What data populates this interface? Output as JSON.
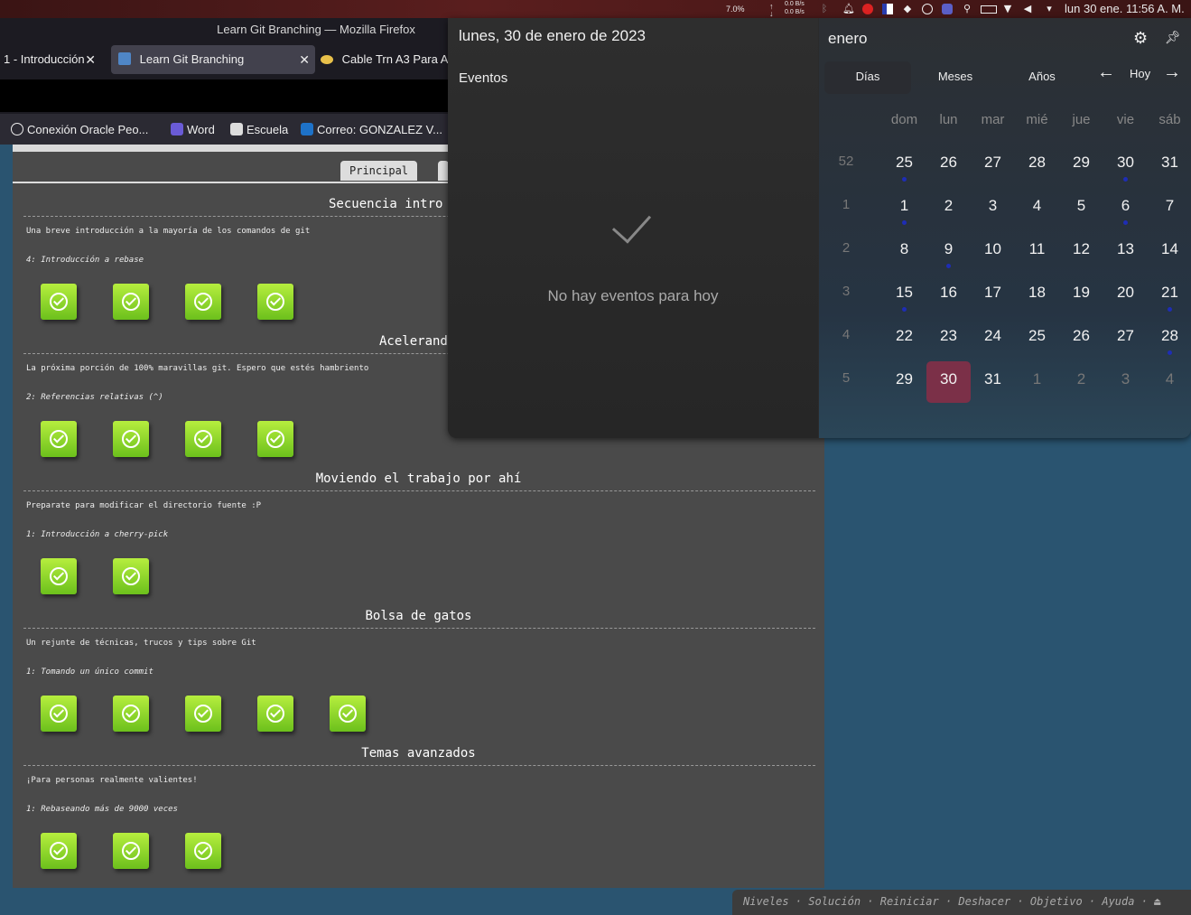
{
  "topbar": {
    "cpu": "7.0%",
    "net_up": "0.0 B/s",
    "net_down": "0.0 B/s",
    "clock": "lun 30 ene.  11:56 A. M."
  },
  "firefox": {
    "window_title": "Learn Git Branching — Mozilla Firefox",
    "tabs": [
      {
        "label": "1 - Introducción"
      },
      {
        "label": "Learn Git Branching"
      },
      {
        "label": "Cable Trn A3 Para A"
      }
    ],
    "bookmarks": [
      {
        "label": "Conexión Oracle Peo..."
      },
      {
        "label": "Word"
      },
      {
        "label": "Escuela"
      },
      {
        "label": "Correo: GONZALEZ V..."
      }
    ]
  },
  "git_page": {
    "tab_main": "Principal",
    "sections": [
      {
        "title": "Secuencia intro",
        "desc": "Una breve introducción a la mayoría de los comandos de git",
        "sub": "4: Introducción a rebase",
        "levels": 4
      },
      {
        "title": "Acelerand",
        "desc": "La próxima porción de 100% maravillas git. Espero que estés hambriento",
        "sub": "2: Referencias relativas (^)",
        "levels": 4
      },
      {
        "title": "Moviendo el trabajo por ahí",
        "desc": "Preparate para modificar el directorio fuente :P",
        "sub": "1: Introducción a cherry-pick",
        "levels": 2
      },
      {
        "title": "Bolsa de gatos",
        "desc": "Un rejunte de técnicas, trucos y tips sobre Git",
        "sub": "1: Tomando un único commit",
        "levels": 5
      },
      {
        "title": "Temas avanzados",
        "desc": "¡Para personas realmente valientes!",
        "sub": "1: Rebaseando más de 9000 veces",
        "levels": 3
      }
    ],
    "bottom_bar": "Niveles · Solución · Reiniciar · Deshacer · Objetivo · Ayuda · ⏏"
  },
  "calendar": {
    "date_header": "lunes, 30 de enero de 2023",
    "events_label": "Eventos",
    "no_events": "No hay eventos para hoy",
    "month": "enero",
    "segments": [
      "Días",
      "Meses",
      "Años"
    ],
    "today_label": "Hoy",
    "weekdays": [
      "dom",
      "lun",
      "mar",
      "mié",
      "jue",
      "vie",
      "sáb"
    ],
    "weeks": [
      {
        "num": "52",
        "days": [
          {
            "d": "25",
            "dot": true
          },
          {
            "d": "26"
          },
          {
            "d": "27"
          },
          {
            "d": "28"
          },
          {
            "d": "29"
          },
          {
            "d": "30",
            "dot": true
          },
          {
            "d": "31"
          }
        ],
        "dim": true
      },
      {
        "num": "1",
        "days": [
          {
            "d": "1",
            "dot": true
          },
          {
            "d": "2"
          },
          {
            "d": "3"
          },
          {
            "d": "4"
          },
          {
            "d": "5"
          },
          {
            "d": "6",
            "dot": true
          },
          {
            "d": "7"
          }
        ]
      },
      {
        "num": "2",
        "days": [
          {
            "d": "8"
          },
          {
            "d": "9",
            "dot": true
          },
          {
            "d": "10"
          },
          {
            "d": "11"
          },
          {
            "d": "12"
          },
          {
            "d": "13"
          },
          {
            "d": "14"
          }
        ]
      },
      {
        "num": "3",
        "days": [
          {
            "d": "15",
            "dot": true
          },
          {
            "d": "16"
          },
          {
            "d": "17"
          },
          {
            "d": "18"
          },
          {
            "d": "19"
          },
          {
            "d": "20"
          },
          {
            "d": "21",
            "dot": true
          }
        ]
      },
      {
        "num": "4",
        "days": [
          {
            "d": "22"
          },
          {
            "d": "23"
          },
          {
            "d": "24"
          },
          {
            "d": "25"
          },
          {
            "d": "26"
          },
          {
            "d": "27"
          },
          {
            "d": "28",
            "dot": true
          }
        ]
      },
      {
        "num": "5",
        "days": [
          {
            "d": "29"
          },
          {
            "d": "30",
            "today": true
          },
          {
            "d": "31"
          },
          {
            "d": "1",
            "dim": true
          },
          {
            "d": "2",
            "dim": true
          },
          {
            "d": "3",
            "dim": true
          },
          {
            "d": "4",
            "dim": true
          }
        ]
      }
    ],
    "today_color": "#7b3048",
    "event_dot_color": "#1e2db5"
  }
}
